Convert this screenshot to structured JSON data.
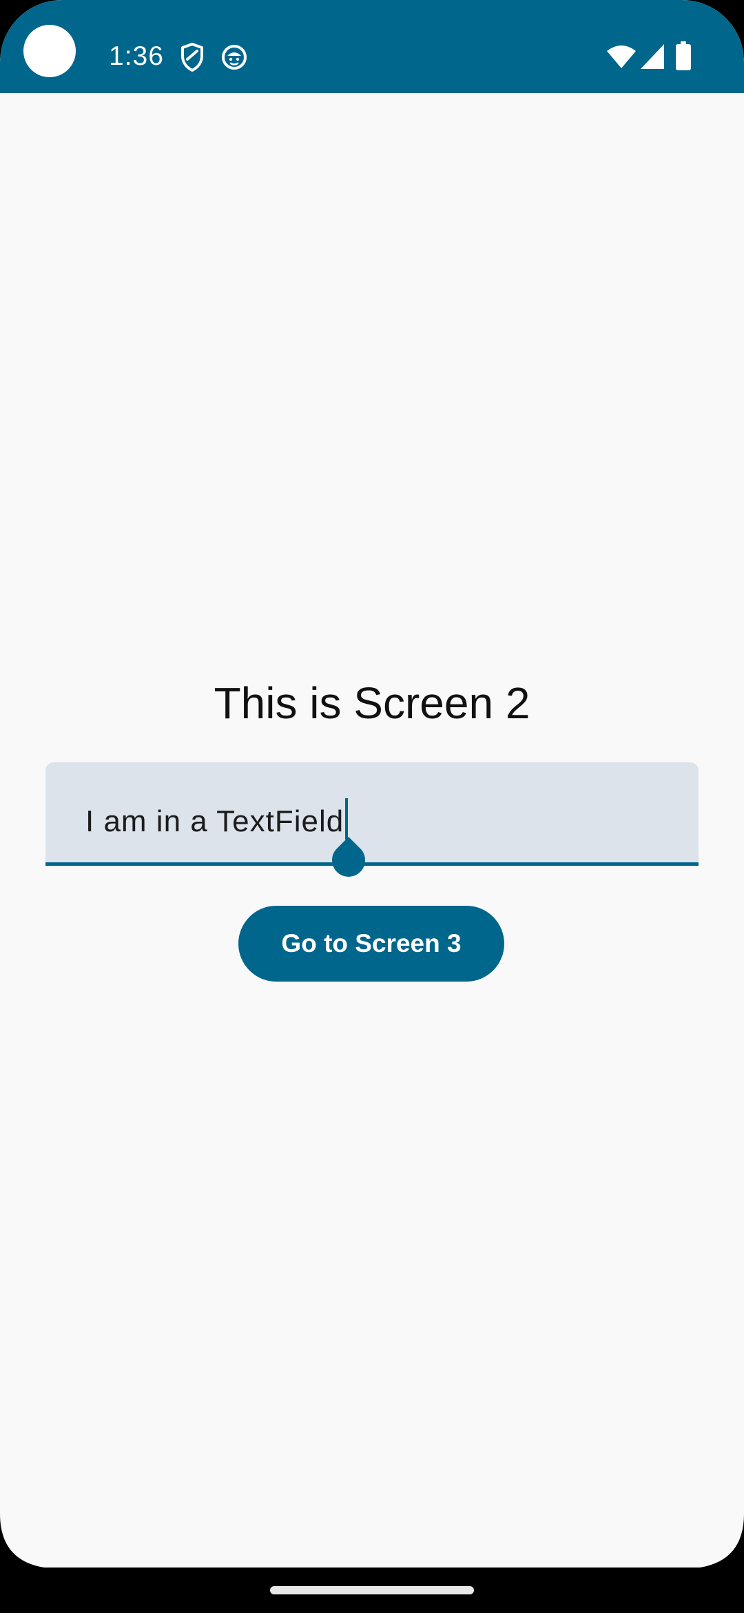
{
  "status_bar": {
    "time": "1:36",
    "icons": [
      "camera-cutout",
      "shield-icon",
      "data-saver-icon",
      "wifi-icon",
      "cell-signal-icon",
      "battery-icon"
    ]
  },
  "main": {
    "title": "This is Screen 2",
    "text_field": {
      "value": "I am in a TextField"
    },
    "button_label": "Go to Screen 3"
  },
  "colors": {
    "primary": "#00668c",
    "background": "#f9f9f9",
    "field_fill": "#dde3ea",
    "on_primary": "#ffffff",
    "text": "#111111"
  }
}
